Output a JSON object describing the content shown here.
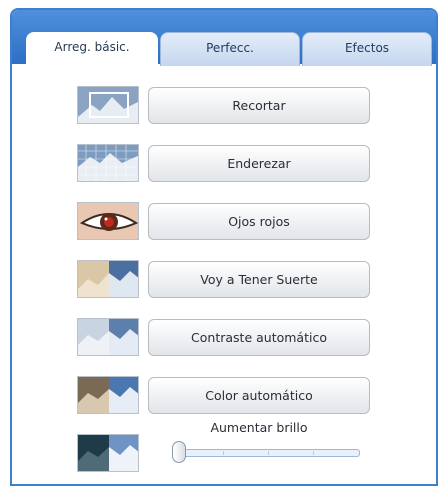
{
  "tabs": [
    {
      "label": "Arreg. básic.",
      "active": true
    },
    {
      "label": "Perfecc.",
      "active": false
    },
    {
      "label": "Efectos",
      "active": false
    }
  ],
  "tools": [
    {
      "label": "Recortar",
      "icon": "crop-thumbnail-icon"
    },
    {
      "label": "Enderezar",
      "icon": "straighten-thumbnail-icon"
    },
    {
      "label": "Ojos rojos",
      "icon": "red-eye-thumbnail-icon"
    },
    {
      "label": "Voy a Tener Suerte",
      "icon": "lucky-thumbnail-icon"
    },
    {
      "label": "Contraste automático",
      "icon": "auto-contrast-thumbnail-icon"
    },
    {
      "label": "Color automático",
      "icon": "auto-color-thumbnail-icon"
    }
  ],
  "brightness": {
    "label": "Aumentar brillo",
    "icon": "brightness-thumbnail-icon",
    "value": 0
  },
  "colors": {
    "accent": "#3f7fd0",
    "button_text": "#2a2e35"
  }
}
